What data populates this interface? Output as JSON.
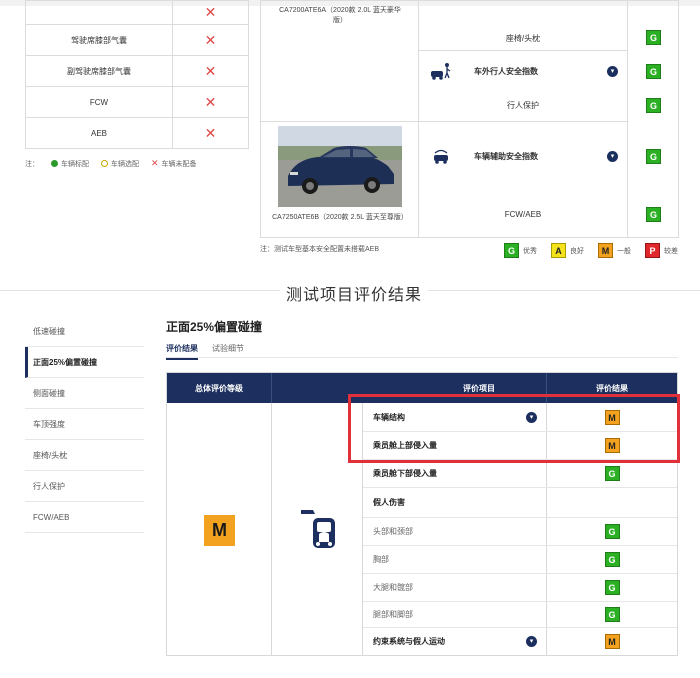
{
  "features_table": {
    "rows": [
      {
        "name": "",
        "value": "✕"
      },
      {
        "name": "驾驶席膝部气囊",
        "value": "✕"
      },
      {
        "name": "副驾驶席膝部气囊",
        "value": "✕"
      },
      {
        "name": "FCW",
        "value": "✕"
      },
      {
        "name": "AEB",
        "value": "✕"
      }
    ],
    "legend": {
      "prefix": "注：",
      "standard": "车辆标配",
      "optional": "车辆选配",
      "none": "车辆未配备"
    }
  },
  "vehicle_table": {
    "car1_label": "CA7200ATE6A（2020款 2.0L 蓝天豪华版）",
    "car2_label": "CA7250ATE6B（2020款 2.5L 蓝天至尊版）",
    "rows": [
      {
        "label": "座椅/头枕",
        "grade": "G"
      },
      {
        "label": "车外行人安全指数",
        "grade": "G"
      },
      {
        "label": "行人保护",
        "grade": "G"
      },
      {
        "label": "车辆辅助安全指数",
        "grade": "G"
      },
      {
        "label": "FCW/AEB",
        "grade": "G"
      }
    ],
    "note": "注：测试车型基本安全配置未搭载AEB",
    "grade_legend": [
      {
        "code": "G",
        "label": "优秀"
      },
      {
        "code": "A",
        "label": "良好"
      },
      {
        "code": "M",
        "label": "一般"
      },
      {
        "code": "P",
        "label": "较差"
      }
    ]
  },
  "section": {
    "title": "测试项目评价结果"
  },
  "side_nav": [
    {
      "label": "低速碰撞",
      "active": false
    },
    {
      "label": "正面25%偏置碰撞",
      "active": true
    },
    {
      "label": "侧面碰撞",
      "active": false
    },
    {
      "label": "车顶强度",
      "active": false
    },
    {
      "label": "座椅/头枕",
      "active": false
    },
    {
      "label": "行人保护",
      "active": false
    },
    {
      "label": "FCW/AEB",
      "active": false
    }
  ],
  "result": {
    "subtitle": "正面25%偏置碰撞",
    "tabs": [
      "评价结果",
      "试验细节"
    ],
    "headers": {
      "overall": "总体评价等级",
      "item": "评价项目",
      "result": "评价结果"
    },
    "overall_grade": "M",
    "items": [
      {
        "name": "车辆结构",
        "grade": "M",
        "expandable": true
      },
      {
        "name": "乘员舱上部侵入量",
        "grade": "M",
        "expandable": false
      },
      {
        "name": "乘员舱下部侵入量",
        "grade": "G",
        "expandable": false
      },
      {
        "name": "假人伤害",
        "grade": "",
        "expandable": false
      },
      {
        "name": "头部和颈部",
        "grade": "G",
        "expandable": false
      },
      {
        "name": "胸部",
        "grade": "G",
        "expandable": false
      },
      {
        "name": "大腿和髋部",
        "grade": "G",
        "expandable": false
      },
      {
        "name": "腿部和脚部",
        "grade": "G",
        "expandable": false
      },
      {
        "name": "约束系统与假人运动",
        "grade": "M",
        "expandable": true
      }
    ]
  }
}
